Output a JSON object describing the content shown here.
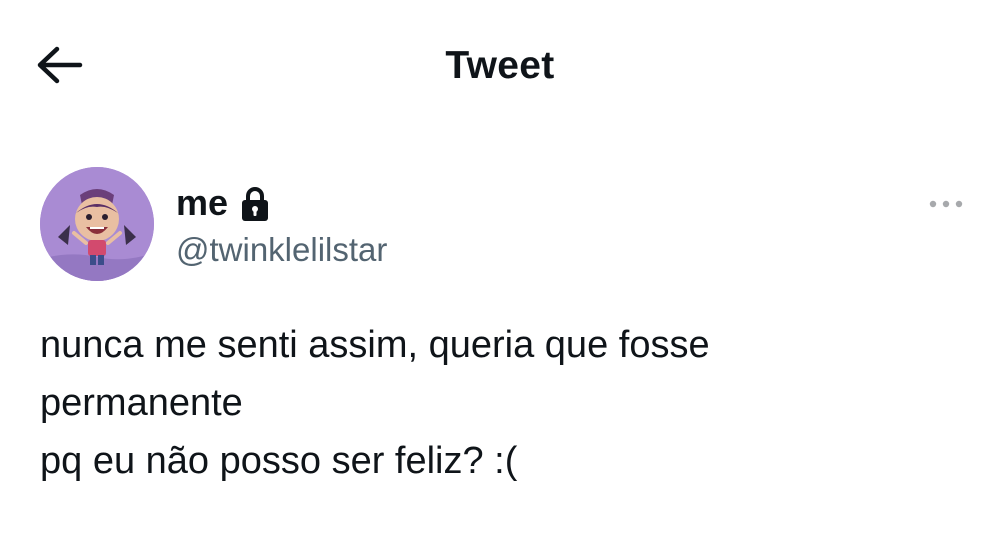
{
  "header": {
    "title": "Tweet",
    "back_icon": "arrow-left-icon"
  },
  "author": {
    "display_name": "me",
    "handle": "@twinklelilstar",
    "protected_icon": "lock-icon",
    "avatar_icon": "cartoon-avatar",
    "avatar_bg": "#a98bd3"
  },
  "tweet": {
    "lines": [
      "nunca me senti assim, queria que fosse",
      "permanente",
      "pq eu não posso ser feliz? :("
    ]
  },
  "more_icon": "ellipsis-icon",
  "colors": {
    "text": "#0f1419",
    "secondary": "#536471",
    "more": "#a7a9ac"
  }
}
